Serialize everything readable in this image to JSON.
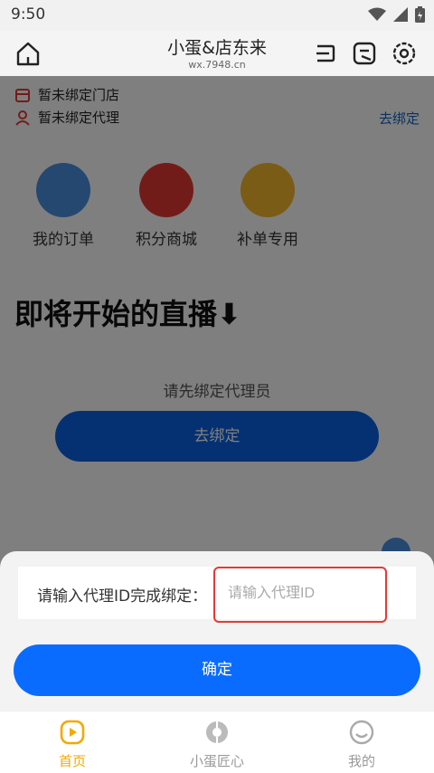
{
  "status": {
    "time": "9:50"
  },
  "nav": {
    "title": "小蛋&店东来",
    "subtitle": "wx.7948.cn"
  },
  "bindings": {
    "store_text": "暂未绑定门店",
    "agent_text": "暂未绑定代理",
    "bind_link": "去绑定"
  },
  "quick_links": [
    {
      "label": "我的订单",
      "icon": "calendar-check-icon"
    },
    {
      "label": "积分商城",
      "icon": "shopping-bag-icon"
    },
    {
      "label": "补单专用",
      "icon": "coupon-icon"
    }
  ],
  "section": {
    "title": "即将开始的直播⬇"
  },
  "empty_hint": "请先绑定代理员",
  "bind_button": "去绑定",
  "sheet": {
    "label": "请输入代理ID完成绑定：",
    "placeholder": "请输入代理ID",
    "value": ""
  },
  "confirm_label": "确定",
  "tabs": [
    {
      "label": "首页",
      "icon": "play-icon",
      "active": true
    },
    {
      "label": "小蛋匠心",
      "icon": "aperture-icon",
      "active": false
    },
    {
      "label": "我的",
      "icon": "smile-icon",
      "active": false
    }
  ],
  "colors": {
    "accent": "#0a6cff",
    "active_tab": "#f2a900",
    "highlight_border": "#e53935"
  }
}
